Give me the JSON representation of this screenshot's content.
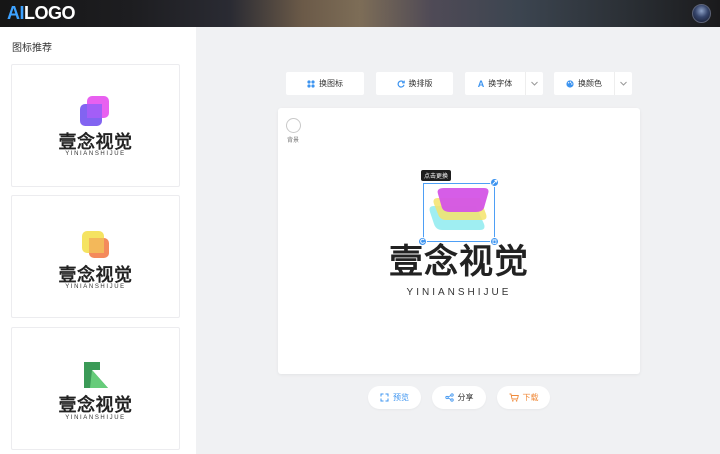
{
  "header": {
    "brand_ai": "AI",
    "brand_logo": "LOGO",
    "avatar_icon": "user-avatar"
  },
  "sidebar": {
    "title": "图标推荐",
    "cards": [
      {
        "name": "壹念视觉",
        "pinyin": "YINIANSHIJUE",
        "icon": "purple-shape-icon"
      },
      {
        "name": "壹念视觉",
        "pinyin": "YINIANSHIJUE",
        "icon": "yellow-shape-icon"
      },
      {
        "name": "壹念视觉",
        "pinyin": "YINIANSHIJUE",
        "icon": "green-shape-icon"
      }
    ]
  },
  "toolbar": {
    "change_icon": "换图标",
    "change_layout": "换排版",
    "change_font": "换字体",
    "change_color": "换颜色"
  },
  "canvas": {
    "background_label": "背景",
    "tooltip": "点击更换",
    "logo_name": "壹念视觉",
    "logo_pinyin": "YINIANSHIJUE"
  },
  "actions": {
    "preview": "预览",
    "share": "分享",
    "download": "下载"
  },
  "colors": {
    "accent_blue": "#3d94f0",
    "download_orange": "#f08a3a"
  }
}
